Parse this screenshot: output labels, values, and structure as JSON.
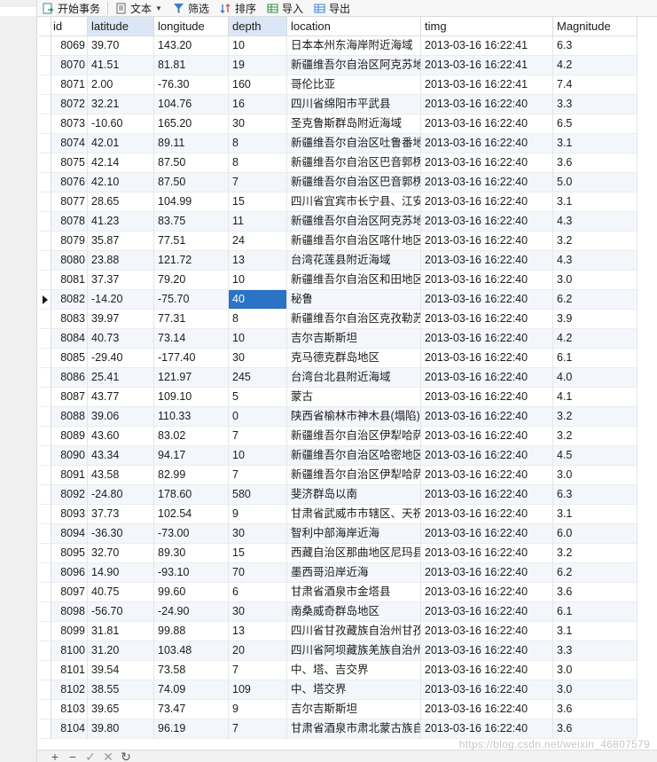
{
  "toolbar": {
    "begin_transaction": "开始事务",
    "text": "文本",
    "filter": "筛选",
    "sort": "排序",
    "import": "导入",
    "export": "导出"
  },
  "columns": {
    "id": "id",
    "latitude": "latitude",
    "longitude": "longitude",
    "depth": "depth",
    "location": "location",
    "timg": "timg",
    "magnitude": "Magnitude"
  },
  "rows": [
    {
      "id": "8069",
      "lat": "39.70",
      "lon": "143.20",
      "depth": "10",
      "loc": "日本本州东海岸附近海域",
      "time": "2013-03-16 16:22:41",
      "mag": "6.3"
    },
    {
      "id": "8070",
      "lat": "41.51",
      "lon": "81.81",
      "depth": "19",
      "loc": "新疆维吾尔自治区阿克苏地区",
      "time": "2013-03-16 16:22:41",
      "mag": "4.2"
    },
    {
      "id": "8071",
      "lat": "2.00",
      "lon": "-76.30",
      "depth": "160",
      "loc": "哥伦比亚",
      "time": "2013-03-16 16:22:41",
      "mag": "7.4"
    },
    {
      "id": "8072",
      "lat": "32.21",
      "lon": "104.76",
      "depth": "16",
      "loc": "四川省绵阳市平武县",
      "time": "2013-03-16 16:22:40",
      "mag": "3.3"
    },
    {
      "id": "8073",
      "lat": "-10.60",
      "lon": "165.20",
      "depth": "30",
      "loc": "圣克鲁斯群岛附近海域",
      "time": "2013-03-16 16:22:40",
      "mag": "6.5"
    },
    {
      "id": "8074",
      "lat": "42.01",
      "lon": "89.11",
      "depth": "8",
      "loc": "新疆维吾尔自治区吐鲁番地区",
      "time": "2013-03-16 16:22:40",
      "mag": "3.1"
    },
    {
      "id": "8075",
      "lat": "42.14",
      "lon": "87.50",
      "depth": "8",
      "loc": "新疆维吾尔自治区巴音郭楞蒙古自治州",
      "time": "2013-03-16 16:22:40",
      "mag": "3.6"
    },
    {
      "id": "8076",
      "lat": "42.10",
      "lon": "87.50",
      "depth": "7",
      "loc": "新疆维吾尔自治区巴音郭楞蒙古自治州",
      "time": "2013-03-16 16:22:40",
      "mag": "5.0"
    },
    {
      "id": "8077",
      "lat": "28.65",
      "lon": "104.99",
      "depth": "15",
      "loc": "四川省宜宾市长宁县、江安县",
      "time": "2013-03-16 16:22:40",
      "mag": "3.1"
    },
    {
      "id": "8078",
      "lat": "41.23",
      "lon": "83.75",
      "depth": "11",
      "loc": "新疆维吾尔自治区阿克苏地区",
      "time": "2013-03-16 16:22:40",
      "mag": "4.3"
    },
    {
      "id": "8079",
      "lat": "35.87",
      "lon": "77.51",
      "depth": "24",
      "loc": "新疆维吾尔自治区喀什地区",
      "time": "2013-03-16 16:22:40",
      "mag": "3.2"
    },
    {
      "id": "8080",
      "lat": "23.88",
      "lon": "121.72",
      "depth": "13",
      "loc": "台湾花莲县附近海域",
      "time": "2013-03-16 16:22:40",
      "mag": "4.3"
    },
    {
      "id": "8081",
      "lat": "37.37",
      "lon": "79.20",
      "depth": "10",
      "loc": "新疆维吾尔自治区和田地区",
      "time": "2013-03-16 16:22:40",
      "mag": "3.0"
    },
    {
      "id": "8082",
      "lat": "-14.20",
      "lon": "-75.70",
      "depth": "40",
      "loc": "秘鲁",
      "time": "2013-03-16 16:22:40",
      "mag": "6.2"
    },
    {
      "id": "8083",
      "lat": "39.97",
      "lon": "77.31",
      "depth": "8",
      "loc": "新疆维吾尔自治区克孜勒苏柯尔克孜自治州",
      "time": "2013-03-16 16:22:40",
      "mag": "3.9"
    },
    {
      "id": "8084",
      "lat": "40.73",
      "lon": "73.14",
      "depth": "10",
      "loc": "吉尔吉斯斯坦",
      "time": "2013-03-16 16:22:40",
      "mag": "4.2"
    },
    {
      "id": "8085",
      "lat": "-29.40",
      "lon": "-177.40",
      "depth": "30",
      "loc": "克马德克群岛地区",
      "time": "2013-03-16 16:22:40",
      "mag": "6.1"
    },
    {
      "id": "8086",
      "lat": "25.41",
      "lon": "121.97",
      "depth": "245",
      "loc": "台湾台北县附近海域",
      "time": "2013-03-16 16:22:40",
      "mag": "4.0"
    },
    {
      "id": "8087",
      "lat": "43.77",
      "lon": "109.10",
      "depth": "5",
      "loc": "蒙古",
      "time": "2013-03-16 16:22:40",
      "mag": "4.1"
    },
    {
      "id": "8088",
      "lat": "39.06",
      "lon": "110.33",
      "depth": "0",
      "loc": "陕西省榆林市神木县(塌陷)",
      "time": "2013-03-16 16:22:40",
      "mag": "3.2"
    },
    {
      "id": "8089",
      "lat": "43.60",
      "lon": "83.02",
      "depth": "7",
      "loc": "新疆维吾尔自治区伊犁哈萨克自治州",
      "time": "2013-03-16 16:22:40",
      "mag": "3.2"
    },
    {
      "id": "8090",
      "lat": "43.34",
      "lon": "94.17",
      "depth": "10",
      "loc": "新疆维吾尔自治区哈密地区(",
      "time": "2013-03-16 16:22:40",
      "mag": "4.5"
    },
    {
      "id": "8091",
      "lat": "43.58",
      "lon": "82.99",
      "depth": "7",
      "loc": "新疆维吾尔自治区伊犁哈萨克自治州",
      "time": "2013-03-16 16:22:40",
      "mag": "3.0"
    },
    {
      "id": "8092",
      "lat": "-24.80",
      "lon": "178.60",
      "depth": "580",
      "loc": "斐济群岛以南",
      "time": "2013-03-16 16:22:40",
      "mag": "6.3"
    },
    {
      "id": "8093",
      "lat": "37.73",
      "lon": "102.54",
      "depth": "9",
      "loc": "甘肃省武威市市辖区、天祝藏族自治县",
      "time": "2013-03-16 16:22:40",
      "mag": "3.1"
    },
    {
      "id": "8094",
      "lat": "-36.30",
      "lon": "-73.00",
      "depth": "30",
      "loc": "智利中部海岸近海",
      "time": "2013-03-16 16:22:40",
      "mag": "6.0"
    },
    {
      "id": "8095",
      "lat": "32.70",
      "lon": "89.30",
      "depth": "15",
      "loc": "西藏自治区那曲地区尼玛县",
      "time": "2013-03-16 16:22:40",
      "mag": "3.2"
    },
    {
      "id": "8096",
      "lat": "14.90",
      "lon": "-93.10",
      "depth": "70",
      "loc": "墨西哥沿岸近海",
      "time": "2013-03-16 16:22:40",
      "mag": "6.2"
    },
    {
      "id": "8097",
      "lat": "40.75",
      "lon": "99.60",
      "depth": "6",
      "loc": "甘肃省酒泉市金塔县",
      "time": "2013-03-16 16:22:40",
      "mag": "3.6"
    },
    {
      "id": "8098",
      "lat": "-56.70",
      "lon": "-24.90",
      "depth": "30",
      "loc": "南桑威奇群岛地区",
      "time": "2013-03-16 16:22:40",
      "mag": "6.1"
    },
    {
      "id": "8099",
      "lat": "31.81",
      "lon": "99.88",
      "depth": "13",
      "loc": "四川省甘孜藏族自治州甘孜县",
      "time": "2013-03-16 16:22:40",
      "mag": "3.1"
    },
    {
      "id": "8100",
      "lat": "31.20",
      "lon": "103.48",
      "depth": "20",
      "loc": "四川省阿坝藏族羌族自治州汶川县",
      "time": "2013-03-16 16:22:40",
      "mag": "3.3"
    },
    {
      "id": "8101",
      "lat": "39.54",
      "lon": "73.58",
      "depth": "7",
      "loc": "中、塔、吉交界",
      "time": "2013-03-16 16:22:40",
      "mag": "3.0"
    },
    {
      "id": "8102",
      "lat": "38.55",
      "lon": "74.09",
      "depth": "109",
      "loc": "中、塔交界",
      "time": "2013-03-16 16:22:40",
      "mag": "3.0"
    },
    {
      "id": "8103",
      "lat": "39.65",
      "lon": "73.47",
      "depth": "9",
      "loc": "吉尔吉斯斯坦",
      "time": "2013-03-16 16:22:40",
      "mag": "3.6"
    },
    {
      "id": "8104",
      "lat": "39.80",
      "lon": "96.19",
      "depth": "7",
      "loc": "甘肃省酒泉市肃北蒙古族自治县",
      "time": "2013-03-16 16:22:40",
      "mag": "3.6"
    }
  ],
  "selected_row_id": "8082",
  "footer": {
    "add": "+",
    "remove": "−",
    "apply": "✓",
    "discard": "✕",
    "refresh": "↻"
  },
  "watermark": "https://blog.csdn.net/weixin_46807579",
  "colors": {
    "header_sorted_bg": "#dbe7f6",
    "alt_row_bg": "#f3f7fc",
    "editing_cell_bg": "#2a73c5"
  }
}
